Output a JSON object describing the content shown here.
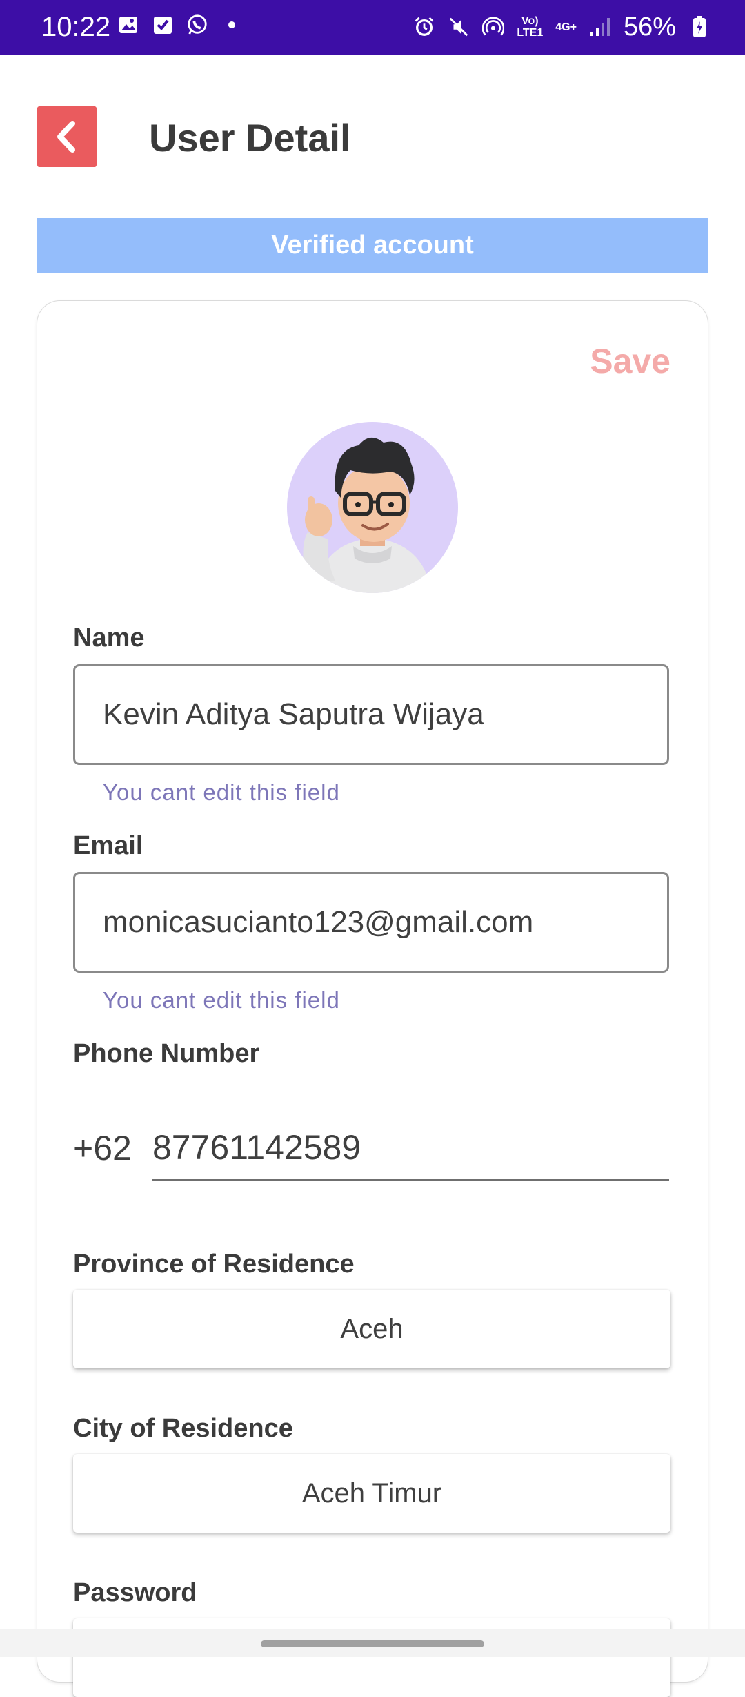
{
  "status_bar": {
    "time": "10:22",
    "network_top": "Vo)",
    "network_bottom": "LTE1",
    "signal_label": "4G+",
    "battery": "56%",
    "icons": [
      "image-icon",
      "check-icon",
      "whatsapp-icon",
      "dot-icon",
      "alarm-icon",
      "mute-icon",
      "hotspot-icon",
      "signal-icon",
      "battery-icon"
    ]
  },
  "header": {
    "title": "User Detail",
    "back_icon": "chevron-left-icon"
  },
  "banner": {
    "text": "Verified account"
  },
  "card": {
    "save_label": "Save",
    "name": {
      "label": "Name",
      "value": "Kevin Aditya Saputra Wijaya",
      "helper": "You cant edit this field"
    },
    "email": {
      "label": "Email",
      "value": "monicasucianto123@gmail.com",
      "helper": "You cant edit this field"
    },
    "phone": {
      "label": "Phone Number",
      "country_code": "+62",
      "value": "87761142589"
    },
    "province": {
      "label": "Province of Residence",
      "value": "Aceh"
    },
    "city": {
      "label": "City of Residence",
      "value": "Aceh Timur"
    },
    "password": {
      "label": "Password"
    }
  },
  "colors": {
    "status_bar": "#3d0ea6",
    "back_button": "#ea5b5e",
    "banner": "#94bdfb",
    "save": "#f4aaa9",
    "helper": "#7d76b8",
    "avatar_bg": "#dcd0fa"
  }
}
